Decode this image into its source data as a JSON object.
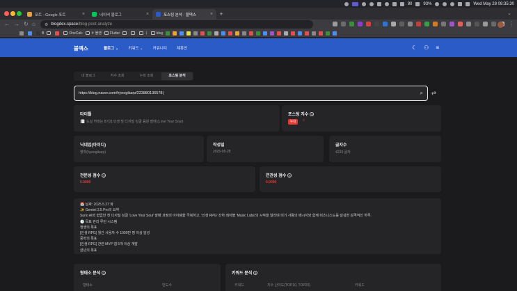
{
  "menubar": {
    "battery": "93%",
    "status_badge": "80",
    "datetime": "Wed May 28  08:35:30"
  },
  "tabs": [
    {
      "label": "포트 - Google 포트",
      "color": "#e8a33b"
    },
    {
      "label": "네이버 블로그",
      "color": "#03c75a"
    },
    {
      "label": "포스팅 분석 - 블덱스",
      "color": "#2a5bc7"
    }
  ],
  "address": {
    "host": "blogdex.space",
    "path": "/blog-post-analyze"
  },
  "bookmarks": [
    {
      "label": "",
      "type": "icon"
    },
    {
      "label": "",
      "type": "icon"
    },
    {
      "label": "B",
      "type": "icon"
    },
    {
      "label": "",
      "type": "folder"
    },
    {
      "label": "",
      "type": "icon"
    },
    {
      "label": "OneCalc",
      "type": "folder"
    },
    {
      "label": "ㅎ 블랜",
      "type": "folder"
    },
    {
      "label": "Flutter",
      "type": "folder"
    },
    {
      "label": "",
      "type": "folder"
    },
    {
      "label": "",
      "type": "folder"
    },
    {
      "label": "ㅣ",
      "type": "folder"
    },
    {
      "label": "blog",
      "type": "folder"
    }
  ],
  "site": {
    "brand": "블덱스",
    "nav": [
      {
        "label": "블로그 ⌄",
        "bold": true
      },
      {
        "label": "키워드 ⌄",
        "bold": false
      },
      {
        "label": "커뮤니티",
        "bold": false
      },
      {
        "label": "제휴안",
        "bold": false
      }
    ]
  },
  "page": {
    "tabs": [
      "내 블로그",
      "지수 조회",
      "누락 조회",
      "포스팅 분석"
    ],
    "active_tab": 3,
    "search_value": "https://blog.naver.com/hyeogikarp/223880136578",
    "title_card": {
      "label": "타이틀",
      "value": "[📑 도실 허락는 8기2] 인생 첫 디지털 싱글 음원 발매 (Love Your Soul)"
    },
    "index_card": {
      "label": "포스팅 지수",
      "badge": "누락"
    },
    "nickname_card": {
      "label": "닉네임(아이디)",
      "value": "영혁(hyeogikarp)"
    },
    "date_card": {
      "label": "작성일",
      "value": "2025-05-28"
    },
    "chars_card": {
      "label": "글자수",
      "value": "4233 글자"
    },
    "expertise_card": {
      "label": "전문성 점수",
      "value": "0.0000"
    },
    "relevance_card": {
      "label": "연관성 점수",
      "value": "0.0000"
    },
    "body_lines": [
      "📅 날짜: 2025.5.27 화",
      "✨ Gemini 2.5 Pro의 요약",
      "Suno AI와 협업한 첫 디지털 싱글 'Love Your Soul' 발매 과정의 아이템을 극복하고, '인생 RPG' 산하 레이블 'Music Labs'의 시작을 알리며 미기 사람의 메시지와 함께 비즈니스도를 달성한 감격적인 하루.",
      "🕒 목표 관리 루틴 시스템",
      "행생의 목표",
      "[인생 RPG] 월간 사용자 수 1000만 명 이상 달성",
      "중력의 목표",
      "[인생 RPG] 관련 MVP 앱 5개 이상 개발",
      "금년의 목표"
    ],
    "bottom": {
      "left_title": "형태소 분석",
      "left_cols": [
        "형태소",
        "빈도수"
      ],
      "right_title": "키워드 분석",
      "right_cols": [
        "키워드",
        "지수 난이도(TOP10, TOP20)",
        "키워드"
      ]
    }
  }
}
